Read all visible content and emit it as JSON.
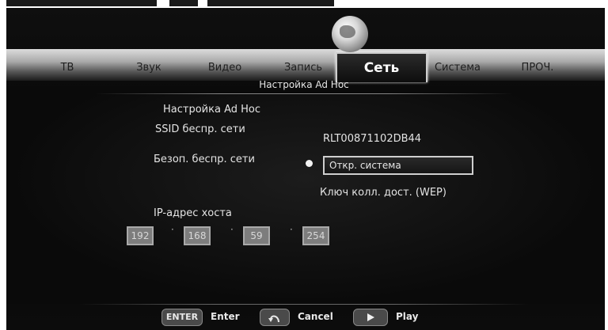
{
  "tabs": [
    {
      "label": "ТВ"
    },
    {
      "label": "Звук"
    },
    {
      "label": "Видео"
    },
    {
      "label": "Запись"
    },
    {
      "label": "Сеть",
      "active": true
    },
    {
      "label": "Система"
    },
    {
      "label": "ПРОЧ."
    }
  ],
  "page": {
    "subtitle": "Настройка Ad Hoc"
  },
  "settings": {
    "heading": "Настройка Ad Hoc",
    "ssid_label": "SSID беспр. сети",
    "ssid_value": "RLT00871102DB44",
    "security_label": "Безоп. беспр. сети",
    "security_value": "Откр. система",
    "key_label": "Ключ колл. дост. (WEP)",
    "ip_label": "IP-адрес хоста",
    "ip_octets": [
      "192",
      "168",
      "59",
      "254"
    ]
  },
  "footer": {
    "enter_key": "ENTER",
    "enter_label": "Enter",
    "cancel_label": "Cancel",
    "play_label": "Play"
  },
  "icons": {
    "network": "globe-icon",
    "cancel": "return-arrow-icon",
    "play": "play-icon"
  }
}
